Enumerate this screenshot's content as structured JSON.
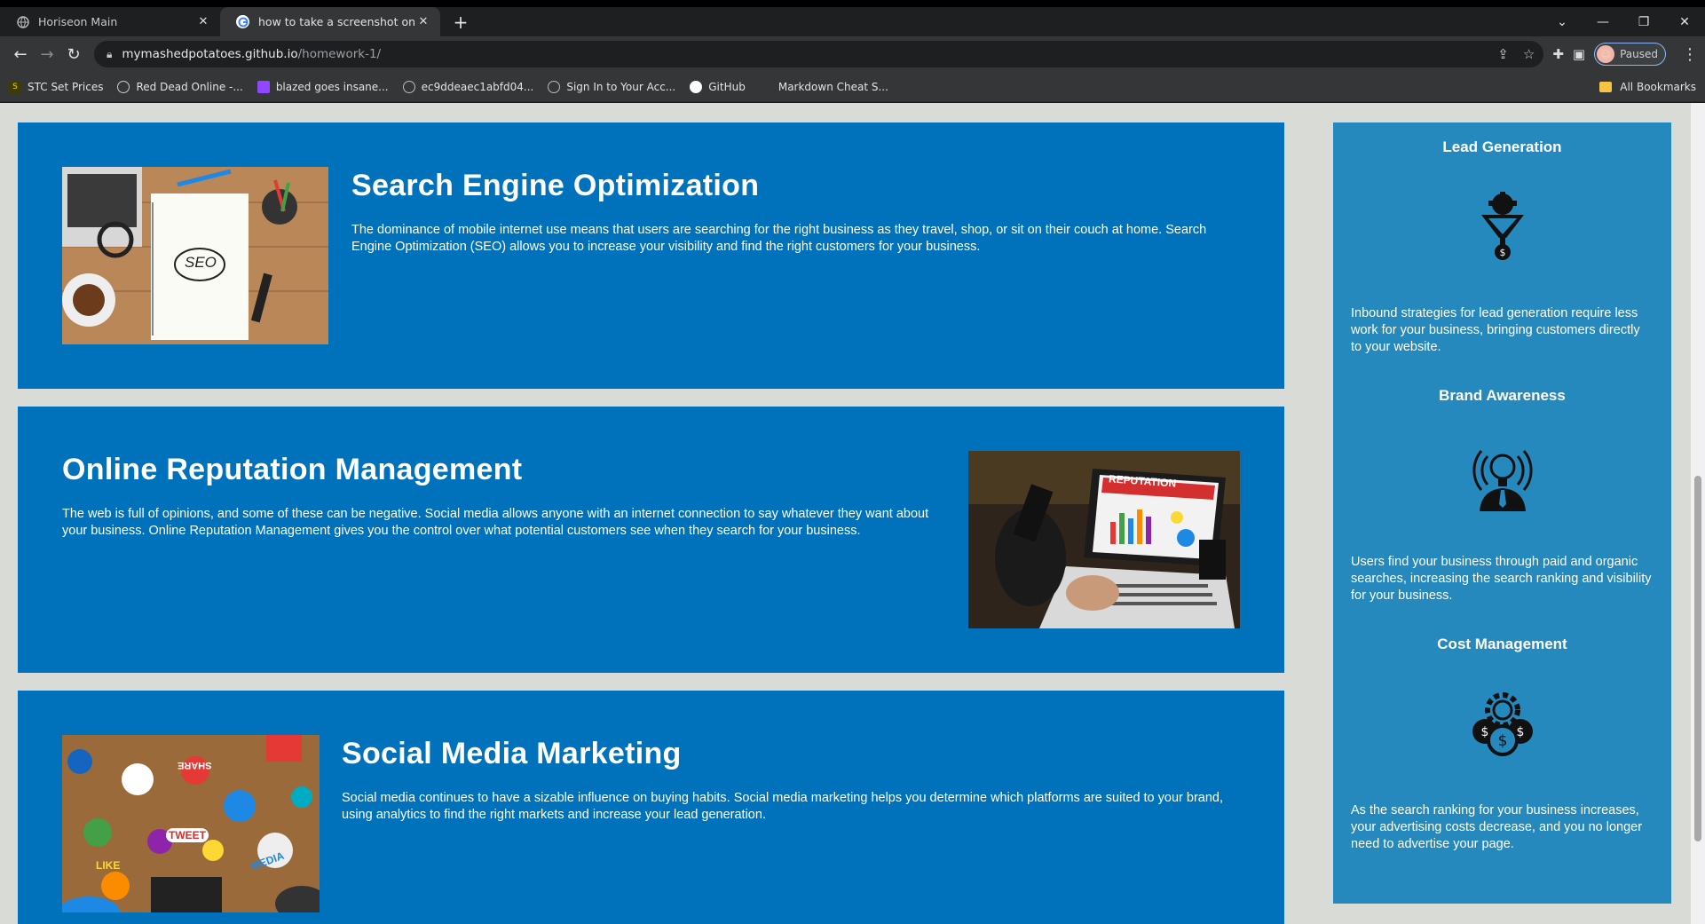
{
  "browser": {
    "tabs": [
      {
        "title": "Horiseon Main",
        "close": "✕"
      },
      {
        "title": "how to take a screenshot on win",
        "close": "✕"
      }
    ],
    "new_tab": "+",
    "url_host": "mymashedpotatoes.github.io",
    "url_path": "/homework-1/",
    "profile_label": "Paused",
    "bookmarks": [
      {
        "label": "STC Set Prices",
        "icon": "s-icon",
        "color": "#3d3d00"
      },
      {
        "label": "Red Dead Online -...",
        "icon": "rdo-icon",
        "color": "#555555"
      },
      {
        "label": "blazed goes insane...",
        "icon": "twitch-icon",
        "color": "#9146ff"
      },
      {
        "label": "ec9ddeaec1abfd04...",
        "icon": "globe-icon",
        "color": "#555555"
      },
      {
        "label": "Sign In to Your Acc...",
        "icon": "globe-icon",
        "color": "#555555"
      },
      {
        "label": "GitHub",
        "icon": "github-icon",
        "color": "#ffffff"
      },
      {
        "label": "Markdown Cheat S...",
        "icon": "doc-icon",
        "color": "#353638"
      }
    ],
    "bookmarks_folder": "All Bookmarks"
  },
  "content": {
    "sections": [
      {
        "title": "Search Engine Optimization",
        "text": "The dominance of mobile internet use means that users are searching for the right business as they travel, shop, or sit on their couch at home. Search Engine Optimization (SEO) allows you to increase your visibility and find the right customers for your business."
      },
      {
        "title": "Online Reputation Management",
        "text": "The web is full of opinions, and some of these can be negative. Social media allows anyone with an internet connection to say whatever they want about your business. Online Reputation Management gives you the control over what potential customers see when they search for your business."
      },
      {
        "title": "Social Media Marketing",
        "text": "Social media continues to have a sizable influence on buying habits. Social media marketing helps you determine which platforms are suited to your brand, using analytics to find the right markets and increase your lead generation."
      }
    ],
    "image_labels": {
      "seo": "SEO",
      "reputation": "REPUTATION",
      "social_tweet": "TWEET",
      "social_like": "LIKE",
      "social_media": "MEDIA",
      "social_share": "SHARE"
    },
    "benefits": [
      {
        "title": "Lead Generation",
        "text": "Inbound strategies for lead generation require less work for your business, bringing customers directly to your website."
      },
      {
        "title": "Brand Awareness",
        "text": "Users find your business through paid and organic searches, increasing the search ranking and visibility for your business."
      },
      {
        "title": "Cost Management",
        "text": "As the search ranking for your business increases, your advertising costs decrease, and you no longer need to advertise your page."
      }
    ]
  },
  "colors": {
    "section_bg": "#0072bb",
    "aside_bg": "#2589bd",
    "page_bg": "#d9dcd6"
  }
}
